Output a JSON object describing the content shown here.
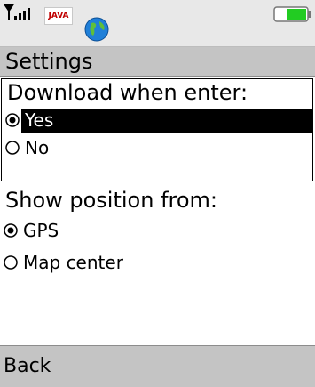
{
  "status_bar": {
    "java_badge": "JAVA",
    "icons": [
      "signal-icon",
      "globe-icon",
      "battery-icon"
    ]
  },
  "title": "Settings",
  "groups": [
    {
      "heading": "Download when enter:",
      "options": [
        {
          "label": "Yes",
          "selected": true,
          "focused": true
        },
        {
          "label": "No",
          "selected": false,
          "focused": false
        }
      ]
    },
    {
      "heading": "Show position from:",
      "options": [
        {
          "label": "GPS",
          "selected": true,
          "focused": false
        },
        {
          "label": "Map center",
          "selected": false,
          "focused": false
        }
      ]
    }
  ],
  "softkeys": {
    "left": "Back"
  },
  "colors": {
    "bar": "#c4c4c4",
    "highlight": "#000000",
    "battery": "#22cc22"
  }
}
